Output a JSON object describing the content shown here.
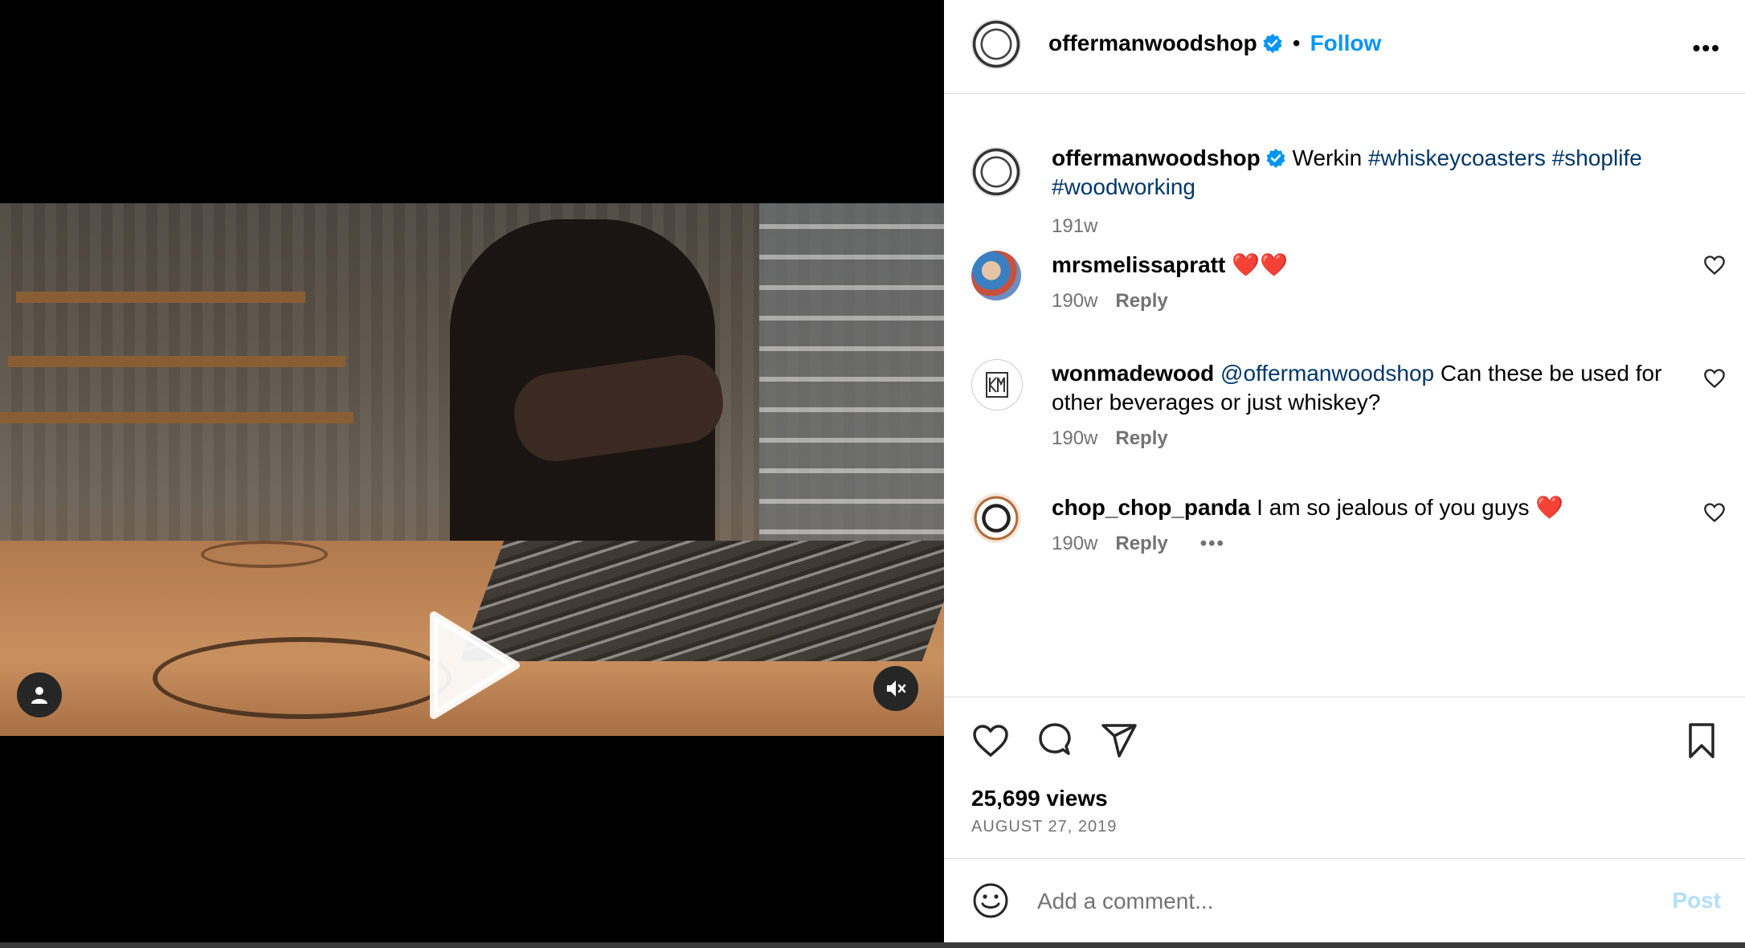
{
  "post": {
    "username": "offermanwoodshop",
    "follow_label": "Follow",
    "more_label": "•••",
    "caption_text": "Werkin",
    "caption_tags": [
      "#whiskeycoasters",
      "#shoplife",
      "#woodworking"
    ],
    "caption_time": "191w"
  },
  "comments": [
    {
      "username": "mrsmelissapratt",
      "text": "❤️❤️",
      "mention": "",
      "time": "190w",
      "reply": "Reply"
    },
    {
      "username": "wonmadewood",
      "mention": "@offermanwoodshop",
      "text": "Can these be used for other beverages or just whiskey?",
      "time": "190w",
      "reply": "Reply"
    },
    {
      "username": "chop_chop_panda",
      "mention": "",
      "text": "I am so jealous of you guys ❤️",
      "time": "190w",
      "reply": "Reply",
      "more": "•••"
    }
  ],
  "stats": {
    "views": "25,699 views",
    "date": "AUGUST 27, 2019"
  },
  "add_comment": {
    "placeholder": "Add a comment...",
    "post_label": "Post"
  },
  "colors": {
    "accent": "#0095f6",
    "hashtag": "#00376b",
    "muted": "#737373",
    "post_disabled": "#b2dffc"
  }
}
